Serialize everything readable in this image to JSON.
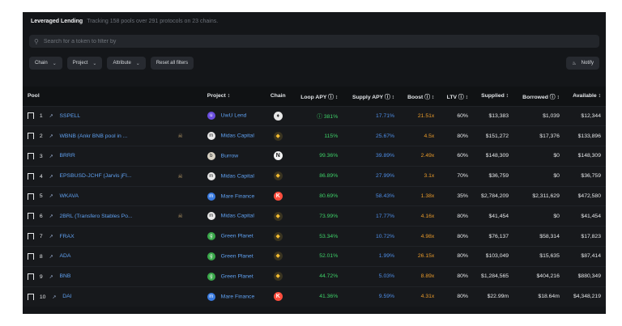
{
  "header": {
    "title": "Leveraged Lending",
    "subtitle": "Tracking 158 pools over 291 protocols on 23 chains."
  },
  "search": {
    "placeholder": "Search for a token to filter by"
  },
  "filters": {
    "chain": "Chain",
    "project": "Project",
    "attribute": "Attribute",
    "reset": "Reset all filters",
    "notify": "Notify"
  },
  "columns": {
    "pool": "Pool",
    "project": "Project ↕",
    "chain": "Chain",
    "loop_apy": "Loop APY ⓘ ↕",
    "supply_apy": "Supply APY ⓘ ↕",
    "boost": "Boost ⓘ ↕",
    "ltv": "LTV ⓘ ↕",
    "supplied": "Supplied ↕",
    "borrowed": "Borrowed ⓘ ↕",
    "available": "Available ↕"
  },
  "colors": {
    "loop_apy": "#3ed068",
    "supply_apy": "#4e8ee8",
    "boost": "#e89a2a",
    "link": "#5fa0f0"
  },
  "rows": [
    {
      "rank": "1",
      "pool": "SSPELL",
      "project": "UwU Lend",
      "project_icon": "uwu-icon",
      "chain_icon": "ethereum-icon",
      "loop_apy": "ⓘ 381%",
      "supply_apy": "17.71%",
      "boost": "21.51x",
      "ltv": "60%",
      "supplied": "$13,383",
      "borrowed": "$1,039",
      "available": "$12,344"
    },
    {
      "rank": "2",
      "pool": "WBNB (Ankr BNB pool in ...",
      "project": "Midas Capital",
      "project_icon": "midas-icon",
      "chain_icon": "bnb-icon",
      "loop_apy": "115%",
      "supply_apy": "25.67%",
      "boost": "4.5x",
      "ltv": "80%",
      "supplied": "$151,272",
      "borrowed": "$17,376",
      "available": "$133,896"
    },
    {
      "rank": "3",
      "pool": "BRRR",
      "project": "Burrow",
      "project_icon": "burrow-icon",
      "chain_icon": "near-icon",
      "loop_apy": "99.36%",
      "supply_apy": "39.89%",
      "boost": "2.49x",
      "ltv": "60%",
      "supplied": "$148,309",
      "borrowed": "$0",
      "available": "$148,309"
    },
    {
      "rank": "4",
      "pool": "EPSBUSD-JCHF (Jarvis jFI...",
      "project": "Midas Capital",
      "project_icon": "midas-icon",
      "chain_icon": "bnb-icon",
      "loop_apy": "86.89%",
      "supply_apy": "27.99%",
      "boost": "3.1x",
      "ltv": "70%",
      "supplied": "$36,759",
      "borrowed": "$0",
      "available": "$36,759"
    },
    {
      "rank": "5",
      "pool": "WKAVA",
      "project": "Mare Finance",
      "project_icon": "mare-icon",
      "chain_icon": "kava-icon",
      "loop_apy": "80.69%",
      "supply_apy": "58.43%",
      "boost": "1.38x",
      "ltv": "35%",
      "supplied": "$2,784,209",
      "borrowed": "$2,311,629",
      "available": "$472,580"
    },
    {
      "rank": "6",
      "pool": "2BRL (Transfero Stables Po...",
      "project": "Midas Capital",
      "project_icon": "midas-icon",
      "chain_icon": "bnb-icon",
      "loop_apy": "73.99%",
      "supply_apy": "17.77%",
      "boost": "4.16x",
      "ltv": "80%",
      "supplied": "$41,454",
      "borrowed": "$0",
      "available": "$41,454"
    },
    {
      "rank": "7",
      "pool": "FRAX",
      "project": "Green Planet",
      "project_icon": "green-planet-icon",
      "chain_icon": "bnb-icon",
      "loop_apy": "53.34%",
      "supply_apy": "10.72%",
      "boost": "4.98x",
      "ltv": "80%",
      "supplied": "$76,137",
      "borrowed": "$58,314",
      "available": "$17,823"
    },
    {
      "rank": "8",
      "pool": "ADA",
      "project": "Green Planet",
      "project_icon": "green-planet-icon",
      "chain_icon": "bnb-icon",
      "loop_apy": "52.01%",
      "supply_apy": "1.99%",
      "boost": "26.15x",
      "ltv": "80%",
      "supplied": "$103,049",
      "borrowed": "$15,635",
      "available": "$87,414"
    },
    {
      "rank": "9",
      "pool": "BNB",
      "project": "Green Planet",
      "project_icon": "green-planet-icon",
      "chain_icon": "bnb-icon",
      "loop_apy": "44.72%",
      "supply_apy": "5.03%",
      "boost": "8.89x",
      "ltv": "80%",
      "supplied": "$1,284,565",
      "borrowed": "$404,216",
      "available": "$880,349"
    },
    {
      "rank": "10",
      "pool": "DAI",
      "project": "Mare Finance",
      "project_icon": "mare-icon",
      "chain_icon": "kava-icon",
      "loop_apy": "41.36%",
      "supply_apy": "9.59%",
      "boost": "4.31x",
      "ltv": "80%",
      "supplied": "$22.99m",
      "borrowed": "$18.64m",
      "available": "$4,348,219"
    }
  ]
}
